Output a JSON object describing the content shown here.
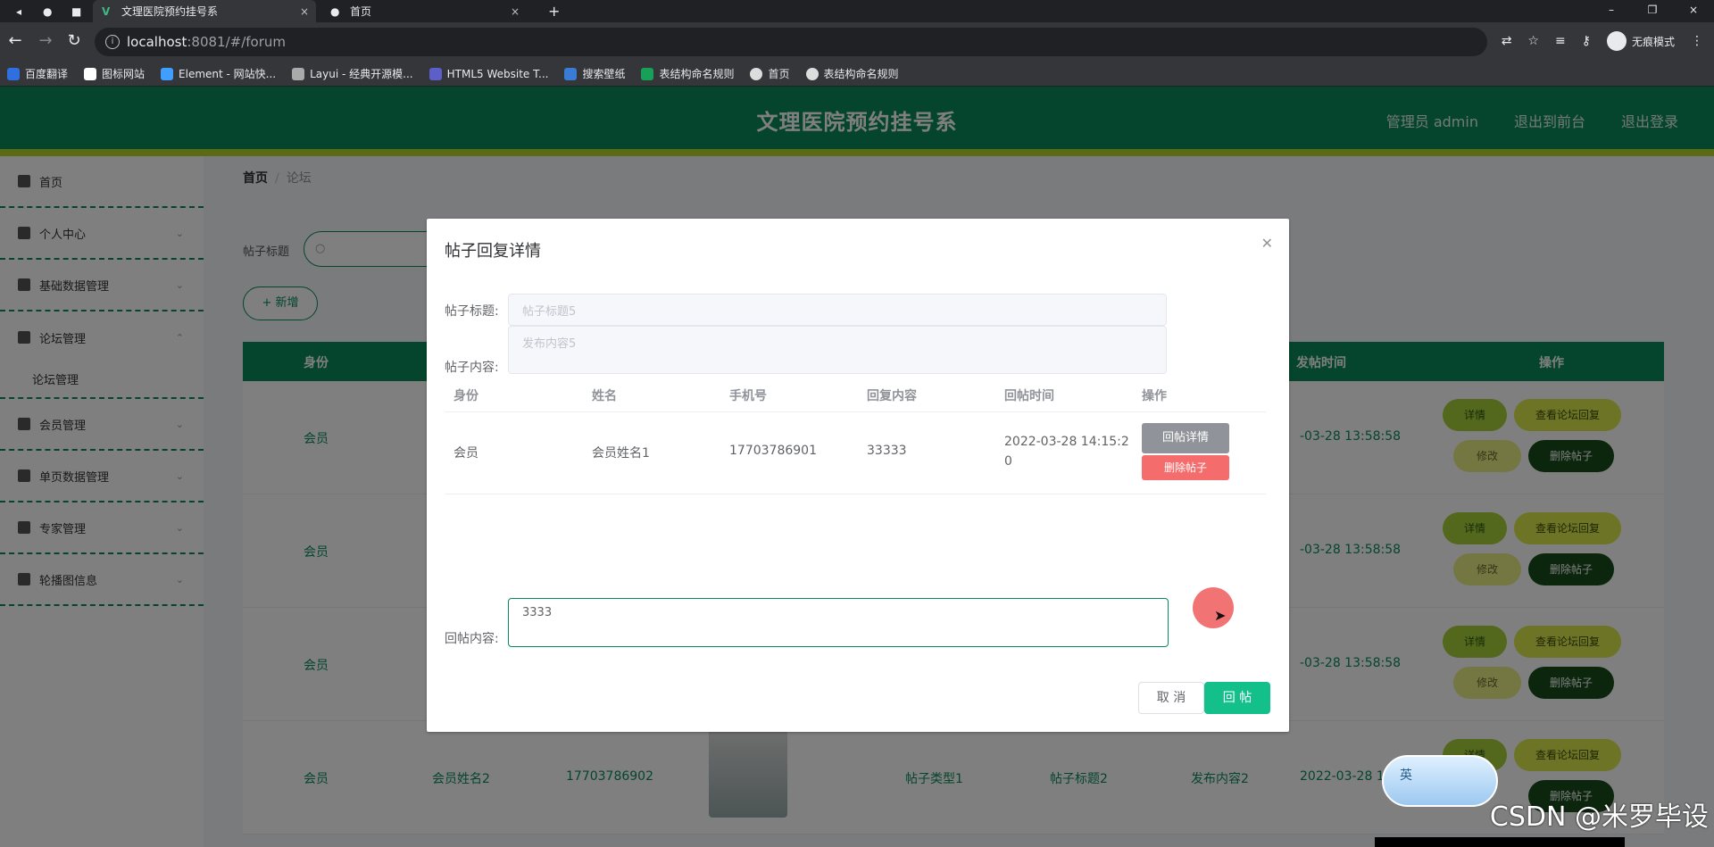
{
  "browser": {
    "tabs": [
      {
        "title": "文理医院预约挂号系",
        "active": true
      },
      {
        "title": "首页",
        "active": false
      }
    ],
    "url_host": "localhost",
    "url_path": ":8081/#/forum",
    "incognito_label": "无痕模式",
    "bookmarks": [
      "百度翻译",
      "图标网站",
      "Element - 网站快...",
      "Layui - 经典开源模...",
      "HTML5 Website T...",
      "搜索壁纸",
      "表结构命名规则",
      "首页",
      "表结构命名规则"
    ]
  },
  "header": {
    "title": "文理医院预约挂号系",
    "user": "管理员 admin",
    "front_link": "退出到前台",
    "logout": "退出登录",
    "accent": "#0a8a5c"
  },
  "sidebar": {
    "items": [
      {
        "label": "首页",
        "icon": "home-icon"
      },
      {
        "label": "个人中心",
        "icon": "user-icon"
      },
      {
        "label": "基础数据管理",
        "icon": "data-icon"
      },
      {
        "label": "论坛管理",
        "icon": "forum-icon"
      },
      {
        "label": "会员管理",
        "icon": "member-icon"
      },
      {
        "label": "单页数据管理",
        "icon": "chart-icon"
      },
      {
        "label": "专家管理",
        "icon": "expert-icon"
      },
      {
        "label": "轮播图信息",
        "icon": "list-icon"
      }
    ],
    "sub_item": "论坛管理"
  },
  "main": {
    "breadcrumb_home": "首页",
    "breadcrumb_sep": "/",
    "breadcrumb_current": "论坛",
    "search_label": "帖子标题",
    "add_button": "+ 新增",
    "columns": [
      "身份",
      "发帖时间",
      "操作"
    ],
    "rows": [
      {
        "identity": "会员",
        "time": "-03-28 13:58:58"
      },
      {
        "identity": "会员",
        "time": "-03-28 13:58:58"
      },
      {
        "identity": "会员",
        "time": "-03-28 13:58:58"
      },
      {
        "identity": "会员",
        "name": "会员姓名2",
        "phone": "17703786902",
        "type": "帖子类型1",
        "title": "帖子标题2",
        "content": "发布内容2",
        "time": "2022-03-28 13:58:5"
      }
    ],
    "row_actions": {
      "detail": "详情",
      "view": "查看论坛回复",
      "edit": "修改",
      "delete": "删除帖子"
    }
  },
  "dialog": {
    "title": "帖子回复详情",
    "post_title_label": "帖子标题:",
    "post_title_value": "帖子标题5",
    "post_content_label": "帖子内容:",
    "post_content_value": "发布内容5",
    "table_headers": [
      "身份",
      "姓名",
      "手机号",
      "回复内容",
      "回帖时间",
      "操作"
    ],
    "replies": [
      {
        "identity": "会员",
        "name": "会员姓名1",
        "phone": "17703786901",
        "content": "33333",
        "time_line1": "2022-03-28 14:15:2",
        "time_line2": "0"
      }
    ],
    "reply_detail_btn": "回帖详情",
    "delete_post_btn": "删除帖子",
    "reply_label": "回帖内容:",
    "reply_value": "3333",
    "cancel": "取 消",
    "submit": "回 帖"
  },
  "overlay_misc": {
    "ime": "英",
    "watermark": "CSDN @米罗毕设"
  }
}
